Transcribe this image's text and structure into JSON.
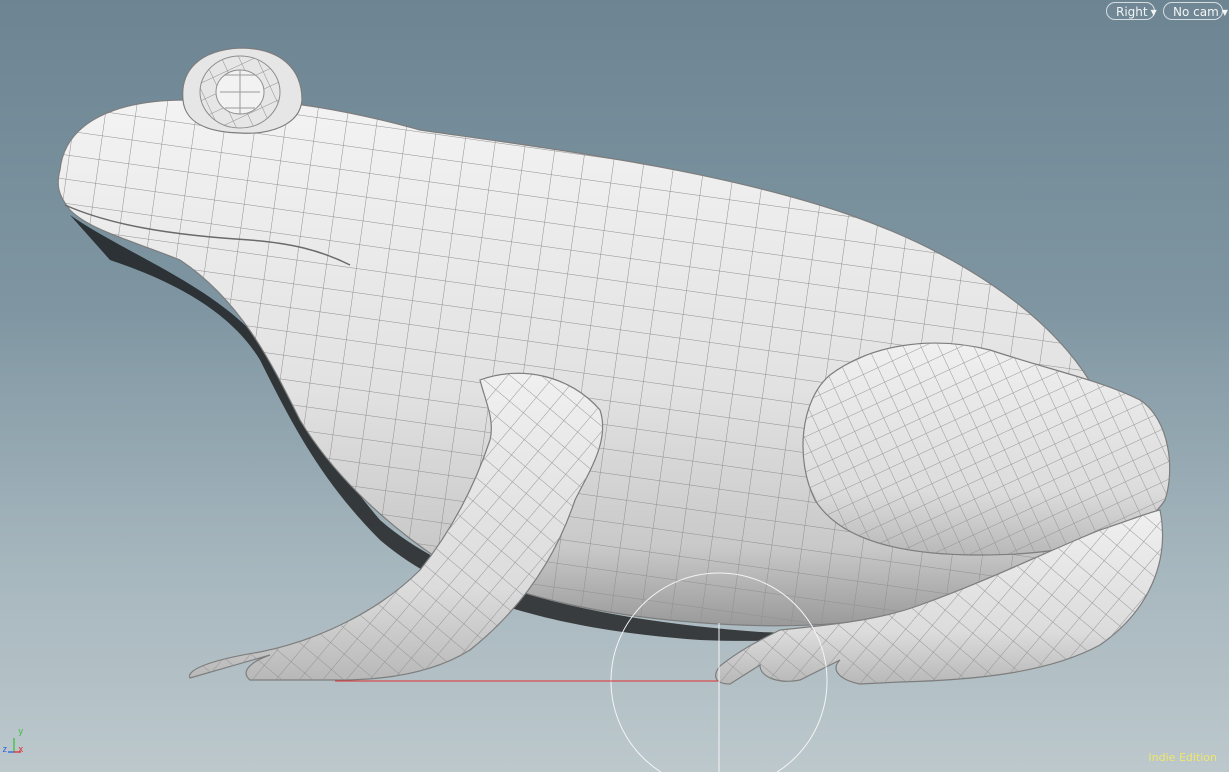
{
  "viewport": {
    "view_menu": {
      "label": "Right",
      "icon": "chevron-down-icon"
    },
    "camera_menu": {
      "label": "No cam",
      "icon": "chevron-down-icon"
    },
    "axis_indicator": {
      "y": "y",
      "z": "z",
      "x": "x"
    },
    "edition_label": "Indie Edition"
  },
  "colors": {
    "background_top": "#6d8593",
    "background_bottom": "#bcc8cc",
    "mesh_fill": "#e6e6e6",
    "wire": "#8f8f8f",
    "edition_text": "#f0e66a",
    "axis_x": "#e03030",
    "axis_y": "#3fbf3f",
    "axis_z": "#3060e0"
  }
}
